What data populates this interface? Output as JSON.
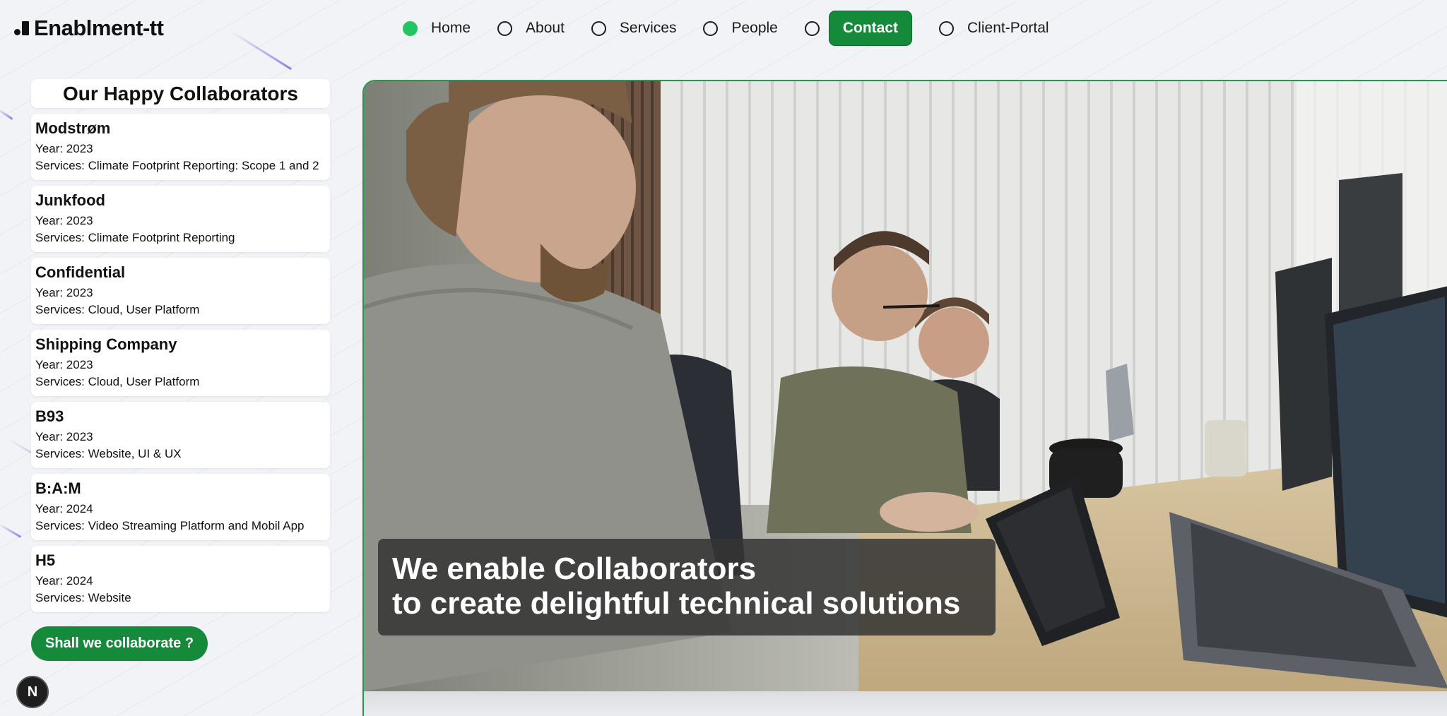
{
  "logo": {
    "text": "Enablment-tt"
  },
  "nav": {
    "items": [
      {
        "label": "Home",
        "active": true
      },
      {
        "label": "About",
        "active": false
      },
      {
        "label": "Services",
        "active": false
      },
      {
        "label": "People",
        "active": false
      },
      {
        "label": "Contact",
        "active": false,
        "style": "button"
      },
      {
        "label": "Client-Portal",
        "active": false
      }
    ]
  },
  "sidebar": {
    "title": "Our Happy Collaborators",
    "collaborators": [
      {
        "name": "Modstrøm",
        "year": "Year: 2023",
        "services": "Services: Climate Footprint Reporting: Scope 1 and 2"
      },
      {
        "name": "Junkfood",
        "year": "Year: 2023",
        "services": "Services: Climate Footprint Reporting"
      },
      {
        "name": "Confidential",
        "year": "Year: 2023",
        "services": "Services: Cloud, User Platform"
      },
      {
        "name": "Shipping Company",
        "year": "Year: 2023",
        "services": "Services: Cloud, User Platform"
      },
      {
        "name": "B93",
        "year": "Year: 2023",
        "services": "Services: Website, UI & UX"
      },
      {
        "name": "B:A:M",
        "year": "Year: 2024",
        "services": "Services: Video Streaming Platform and Mobil App"
      },
      {
        "name": "H5",
        "year": "Year: 2024",
        "services": "Services: Website"
      }
    ],
    "cta_label": "Shall we collaborate ?"
  },
  "hero": {
    "headline_line1": "We enable Collaborators",
    "headline_line2": "to create delightful technical solutions",
    "image_icon": "office-team-photo"
  },
  "badge": {
    "letter": "N"
  },
  "colors": {
    "accent": "#158a3b",
    "active_dot": "#22c55e",
    "hero_border": "#1f9d46",
    "background": "#f1f3f6"
  }
}
